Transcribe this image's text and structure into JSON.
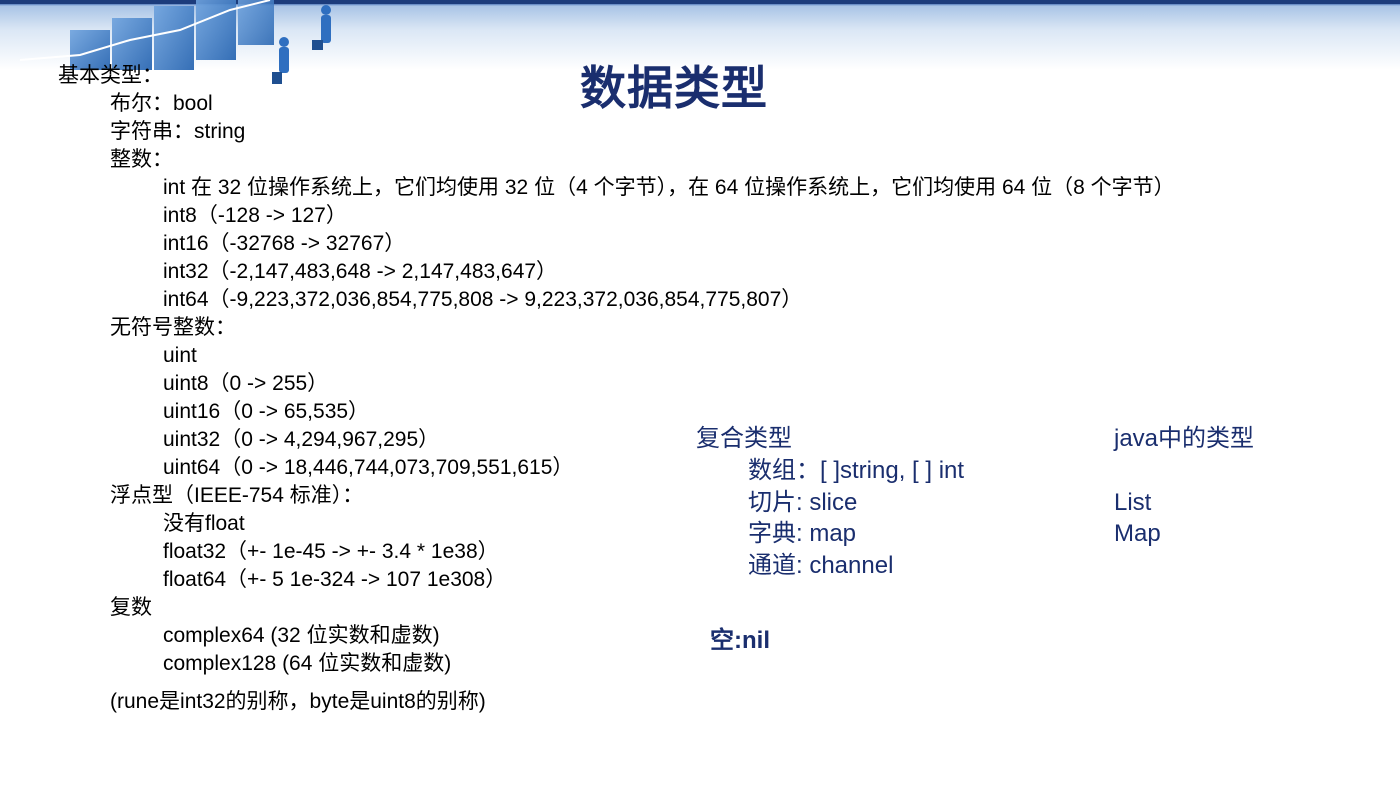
{
  "slide": {
    "title": "数据类型"
  },
  "basic": {
    "heading": "基本类型：",
    "bool": "布尔：bool",
    "string": "字符串：string",
    "int_heading": "整数：",
    "int_items": [
      "int 在 32 位操作系统上，它们均使用 32 位（4 个字节），在 64 位操作系统上，它们均使用 64 位（8 个字节）",
      "int8（-128 -> 127）",
      "int16（-32768 -> 32767）",
      "int32（-2,147,483,648 -> 2,147,483,647）",
      "int64（-9,223,372,036,854,775,808 -> 9,223,372,036,854,775,807）"
    ],
    "uint_heading": "无符号整数：",
    "uint_items": [
      "uint",
      "uint8（0 -> 255）",
      "uint16（0 -> 65,535）",
      "uint32（0 -> 4,294,967,295）",
      "uint64（0 -> 18,446,744,073,709,551,615）"
    ],
    "float_heading": "浮点型（IEEE-754 标准）：",
    "float_items": [
      "没有float",
      "float32（+- 1e-45 -> +- 3.4 * 1e38）",
      "float64（+- 5 1e-324 -> 107 1e308）"
    ],
    "complex_heading": "复数",
    "complex_items": [
      "complex64 (32 位实数和虚数)",
      "complex128 (64 位实数和虚数)"
    ],
    "note": "(rune是int32的别称，byte是uint8的别称)"
  },
  "composite": {
    "heading": "复合类型",
    "array": "数组：[ ]string, [ ] int",
    "slice": "切片: slice",
    "map": "字典: map",
    "channel": "通道: channel",
    "nil": "空:nil"
  },
  "java": {
    "heading": "java中的类型",
    "list": "List",
    "map": "Map"
  },
  "colors": {
    "accent": "#1a2e6e",
    "band": "#1c3c7c"
  }
}
